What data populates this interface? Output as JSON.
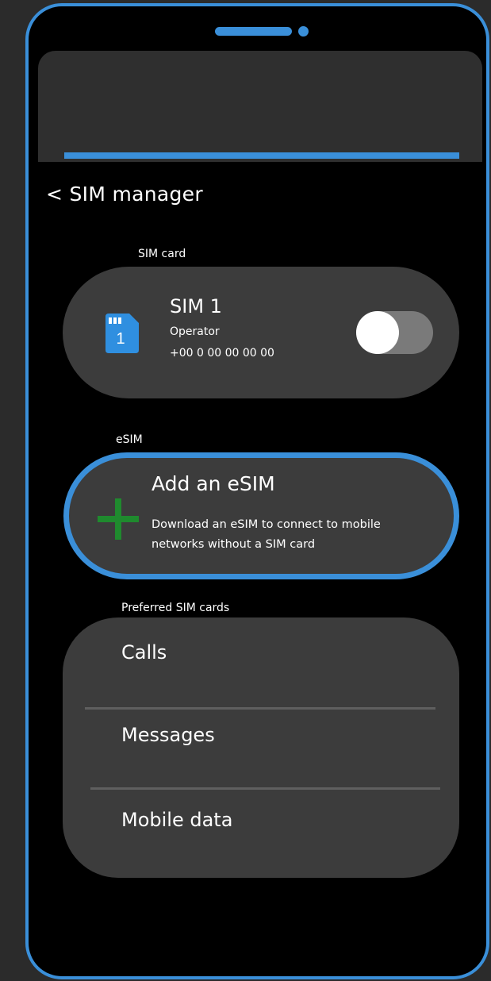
{
  "screen": {
    "title": "< SIM manager"
  },
  "sim_section": {
    "label": "SIM card",
    "sim": {
      "name": "SIM 1",
      "slot_number": "1",
      "operator": "Operator",
      "number": "+00 0 00 00 00 00",
      "enabled": true
    }
  },
  "esim_section": {
    "label": "eSIM",
    "add_title": "Add an eSIM",
    "add_description": "Download an eSIM to connect to mobile networks without a SIM card"
  },
  "preferred_section": {
    "label": "Preferred SIM cards",
    "items": [
      {
        "label": "Calls"
      },
      {
        "label": "Messages"
      },
      {
        "label": "Mobile data"
      }
    ]
  },
  "colors": {
    "accent": "#3a8fd9",
    "card": "#3c3c3c",
    "background": "#000000",
    "plus": "#1f8a2e"
  },
  "icons": {
    "sim": "sim-card-icon",
    "add": "plus-icon"
  }
}
